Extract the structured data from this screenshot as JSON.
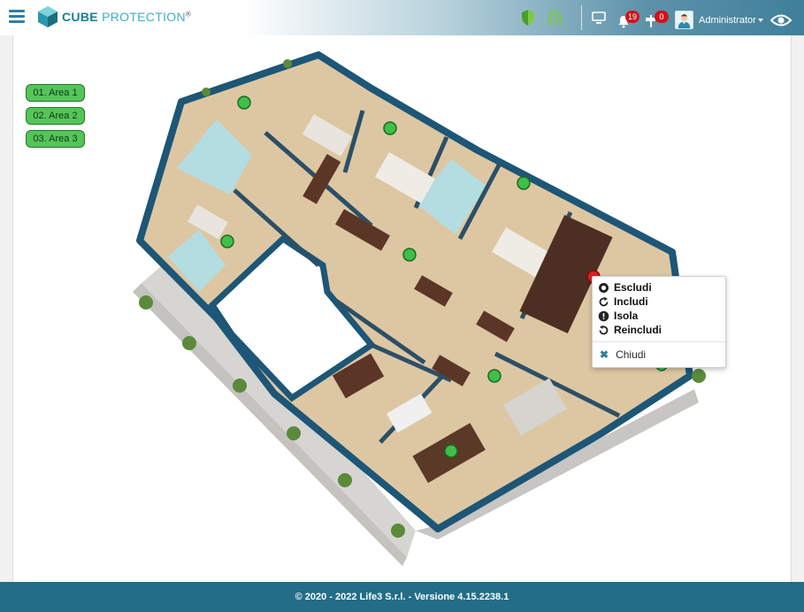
{
  "header": {
    "brand_bold": "CUBE",
    "brand_rest": "PROTECTION",
    "brand_mark": "®",
    "notifications_count": "19",
    "alerts_count": "0",
    "user_name": "Administrator",
    "icons": [
      "menu-icon",
      "shield-icon",
      "fingerprint-icon",
      "monitor-icon",
      "bell-icon",
      "signpost-icon",
      "user-avatar-icon",
      "eye-icon"
    ],
    "colors": {
      "brand": "#1e7e91",
      "badge": "#d0131b"
    }
  },
  "areas": [
    {
      "label": "01. Area 1"
    },
    {
      "label": "02. Area 2"
    },
    {
      "label": "03. Area 3"
    }
  ],
  "context_menu": {
    "items": [
      {
        "label": "Escludi",
        "icon": "circle-icon"
      },
      {
        "label": "Includi",
        "icon": "redo-icon"
      },
      {
        "label": "Isola",
        "icon": "exclamation-circle-icon"
      },
      {
        "label": "Reincludi",
        "icon": "undo-icon"
      }
    ],
    "close_label": "Chiudi"
  },
  "sensor_colors": {
    "ok": "#3fbf4a",
    "alarm": "#d82020"
  },
  "footer": {
    "text": "© 2020 - 2022 Life3 S.r.l. - Versione 4.15.2238.1"
  }
}
